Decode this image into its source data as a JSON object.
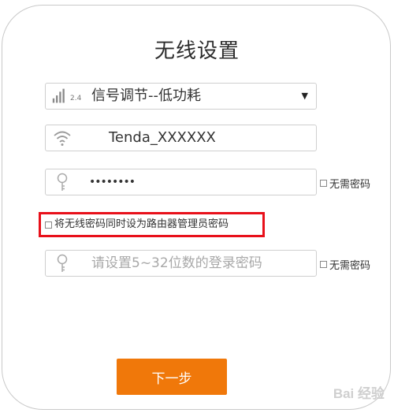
{
  "page_title": "无线设置",
  "signal_select": {
    "icon": "signal-strength-icon",
    "icon_label": "2.4",
    "value": "信号调节--低功耗"
  },
  "ssid_field": {
    "icon": "wifi-icon",
    "value": "Tenda_XXXXXX"
  },
  "wifi_password_field": {
    "icon": "key-icon",
    "value": "••••••••"
  },
  "wifi_no_password_label": "无需密码",
  "sync_checkbox_label": "将无线密码同时设为路由器管理员密码",
  "admin_password_field": {
    "icon": "key-icon",
    "placeholder": "请设置5~32位数的登录密码"
  },
  "admin_no_password_label": "无需密码",
  "next_button_label": "下一步",
  "watermark": "Bai 经验",
  "colors": {
    "accent_button": "#f0780a",
    "highlight_border": "#e8101a"
  }
}
